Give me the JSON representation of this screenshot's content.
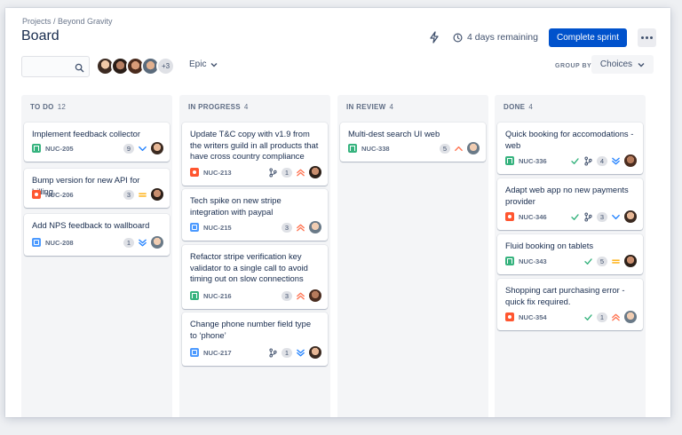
{
  "breadcrumb": "Projects / Beyond Gravity",
  "title": "Board",
  "sprint": {
    "remaining": "4 days remaining",
    "complete_label": "Complete sprint"
  },
  "toolbar": {
    "search_placeholder": "",
    "extra_members": "+3",
    "epic_label": "Epic",
    "group_by_label": "GROUP BY",
    "choices_label": "Choices"
  },
  "colors": {
    "primary": "#0052cc",
    "story": "#36b37e",
    "bug": "#ff5630",
    "task": "#4c9aff",
    "priority_high": "#ff7452",
    "priority_low": "#2684ff",
    "priority_medium": "#ffab00",
    "done_check": "#36b37e"
  },
  "columns": [
    {
      "title": "TO DO",
      "count": "12",
      "cards": [
        {
          "title": "Implement feedback collector",
          "key": "NUC-205",
          "type": "story",
          "estimate": "9",
          "priority": "low",
          "branch": false,
          "done": false
        },
        {
          "title": "Bump version for new API for billing",
          "key": "NUC-206",
          "type": "bug",
          "estimate": "3",
          "priority": "medium",
          "branch": false,
          "done": false
        },
        {
          "title": "Add NPS feedback to wallboard",
          "key": "NUC-208",
          "type": "task",
          "estimate": "1",
          "priority": "lowest",
          "branch": false,
          "done": false
        }
      ]
    },
    {
      "title": "IN PROGRESS",
      "count": "4",
      "cards": [
        {
          "title": "Update T&C copy with v1.9 from the writers guild in all products that have cross country compliance",
          "key": "NUC-213",
          "type": "bug",
          "estimate": "1",
          "priority": "highest",
          "branch": true,
          "done": false
        },
        {
          "title": "Tech spike on new stripe integration with paypal",
          "key": "NUC-215",
          "type": "task",
          "estimate": "3",
          "priority": "highest",
          "branch": false,
          "done": false
        },
        {
          "title": "Refactor stripe verification key validator to a single call to avoid timing out on slow connections",
          "key": "NUC-216",
          "type": "story",
          "estimate": "3",
          "priority": "highest",
          "branch": false,
          "done": false
        },
        {
          "title": "Change phone number field type to ‘phone’",
          "key": "NUC-217",
          "type": "task",
          "estimate": "1",
          "priority": "lowest",
          "branch": true,
          "done": false
        }
      ]
    },
    {
      "title": "IN REVIEW",
      "count": "4",
      "cards": [
        {
          "title": "Multi-dest search UI web",
          "key": "NUC-338",
          "type": "story",
          "estimate": "5",
          "priority": "high",
          "branch": false,
          "done": false
        }
      ]
    },
    {
      "title": "DONE",
      "count": "4",
      "cards": [
        {
          "title": "Quick booking for accomodations - web",
          "key": "NUC-336",
          "type": "story",
          "estimate": "4",
          "priority": "lowest",
          "branch": true,
          "done": true
        },
        {
          "title": "Adapt web app no new payments provider",
          "key": "NUC-346",
          "type": "bug",
          "estimate": "3",
          "priority": "low",
          "branch": true,
          "done": true
        },
        {
          "title": "Fluid booking on tablets",
          "key": "NUC-343",
          "type": "story",
          "estimate": "5",
          "priority": "medium",
          "branch": false,
          "done": true
        },
        {
          "title": "Shopping cart purchasing error - quick fix required.",
          "key": "NUC-354",
          "type": "bug",
          "estimate": "1",
          "priority": "highest",
          "branch": false,
          "done": true
        }
      ]
    }
  ]
}
